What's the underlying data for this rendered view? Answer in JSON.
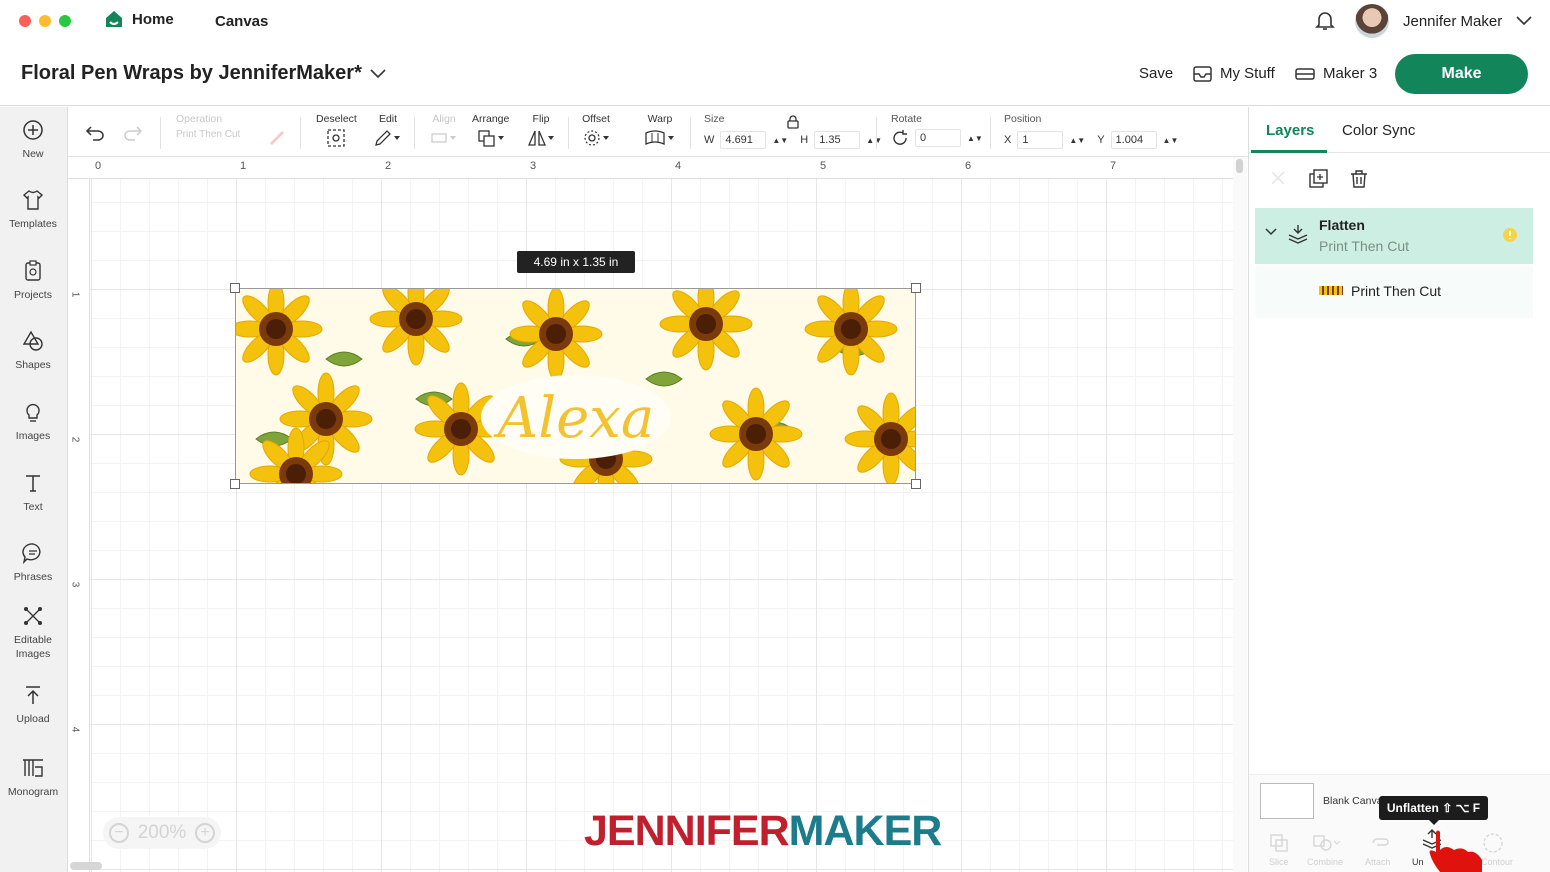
{
  "titlebar": {
    "home": "Home",
    "canvas": "Canvas",
    "user_name": "Jennifer Maker"
  },
  "header": {
    "project_title": "Floral Pen Wraps by JenniferMaker*",
    "save": "Save",
    "my_stuff": "My Stuff",
    "machine": "Maker 3",
    "make": "Make"
  },
  "sidebar": {
    "items": [
      {
        "label": "New",
        "icon": "plus-circle-icon"
      },
      {
        "label": "Templates",
        "icon": "shirt-icon"
      },
      {
        "label": "Projects",
        "icon": "clipboard-icon"
      },
      {
        "label": "Shapes",
        "icon": "shapes-icon"
      },
      {
        "label": "Images",
        "icon": "lightbulb-icon"
      },
      {
        "label": "Text",
        "icon": "text-icon"
      },
      {
        "label": "Phrases",
        "icon": "speech-bubble-icon"
      },
      {
        "label": "Editable\nImages",
        "icon": "editable-image-icon"
      },
      {
        "label": "Upload",
        "icon": "upload-icon"
      },
      {
        "label": "Monogram",
        "icon": "monogram-icon"
      }
    ]
  },
  "toolbar": {
    "operation": "Operation",
    "operation_value": "Print Then Cut",
    "deselect": "Deselect",
    "edit": "Edit",
    "align": "Align",
    "arrange": "Arrange",
    "flip": "Flip",
    "offset": "Offset",
    "warp": "Warp",
    "size": "Size",
    "w_label": "W",
    "w_value": "4.691",
    "h_label": "H",
    "h_value": "1.35",
    "rotate": "Rotate",
    "rotate_value": "0",
    "position": "Position",
    "x_label": "X",
    "x_value": "1",
    "y_label": "Y",
    "y_value": "1.004"
  },
  "ruler": {
    "h": [
      "0",
      "1",
      "2",
      "3",
      "4",
      "5",
      "6",
      "7"
    ],
    "v": [
      "1",
      "2",
      "3",
      "4"
    ]
  },
  "canvas": {
    "size_tooltip": "4.69  in x 1.35  in",
    "wrap_name": "Alexa",
    "zoom": "200%",
    "watermark_red": "JENNIFER",
    "watermark_teal": "MAKER"
  },
  "layers_panel": {
    "tab_layers": "Layers",
    "tab_color_sync": "Color Sync",
    "group_name": "Flatten",
    "group_sub": "Print Then Cut",
    "layer_name": "Print Then Cut",
    "blank_canvas": "Blank Canva",
    "tooltip": "Unflatten ⇧ ⌥ F",
    "bottom_tools": [
      "Slice",
      "Combine",
      "Attach",
      "Un",
      "Contour"
    ]
  },
  "colors": {
    "accent": "#12855a",
    "group_bg": "#cdeee2",
    "watermark_red": "#c0202e",
    "watermark_teal": "#1d7c8c"
  }
}
